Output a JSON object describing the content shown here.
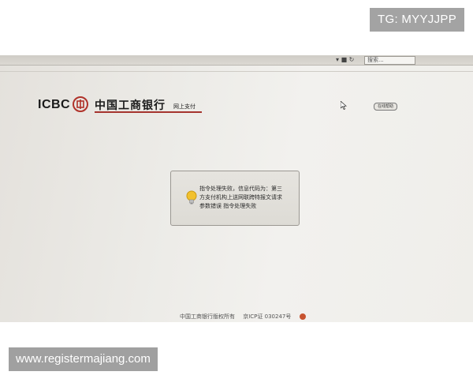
{
  "watermarks": {
    "top_right": "TG: MYYJJPP",
    "bottom_left": "www.registermajiang.com"
  },
  "browser": {
    "search_placeholder": "搜索..."
  },
  "header": {
    "logo_latin": "ICBC",
    "logo_chinese": "中国工商银行",
    "logo_sub": "网上支付",
    "help_label": "在线帮助"
  },
  "message": {
    "line1": "指令处理失败，信息代码为：第三",
    "line2": "方支付机构上送网联跨特报文请求",
    "line3": "参数错误 指令处理失败"
  },
  "footer": {
    "copyright": "中国工商银行版权所有",
    "icp": "京ICP证 030247号"
  },
  "colors": {
    "brand_red": "#a5342e",
    "screen_bg": "#ecebe7"
  }
}
